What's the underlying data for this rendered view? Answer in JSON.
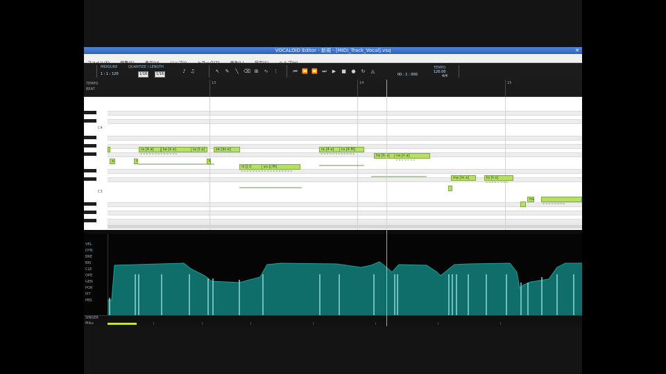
{
  "window": {
    "title": "VOCALOID Editor - 新規 - [MIDI_Track_Vocal].vsq",
    "close_glyph": "✕"
  },
  "menu": [
    "ファイル(F)",
    "編集(E)",
    "表示(V)",
    "ジョブ(J)",
    "トラック(T)",
    "再生(L)",
    "設定(S)",
    "ヘルプ(H)"
  ],
  "toolbar": {
    "measure_label": "MEASURE",
    "quantize_label": "QUANTIZE / LENGTH",
    "position_value": "1 : 1 : 120",
    "quantize_value": "1/16",
    "length_value": "1/16",
    "time_value": "00 : 1 : 000",
    "tempo_label": "TEMPO",
    "tempo_value": "120.00",
    "beat_value": "4/4"
  },
  "ruler": {
    "labels": [
      "TEMPO",
      "BEAT"
    ],
    "measures": [
      "13",
      "14",
      "15"
    ]
  },
  "keyboard": {
    "octave_labels": [
      "C4",
      "C3"
    ]
  },
  "notes": [
    {
      "lyric": "a"
    },
    {
      "lyric": "a [a]"
    },
    {
      "lyric": "ra [4 a]"
    },
    {
      "lyric": "ke [k e]"
    },
    {
      "lyric": "ta [t a]"
    },
    {
      "lyric": "no [n o]"
    },
    {
      "lyric": "ka [k a]"
    },
    {
      "lyric": "ze [dz e]"
    },
    {
      "lyric": "ni [J i]"
    },
    {
      "lyric": "yu [j M]"
    },
    {
      "lyric": "re [4 e]"
    },
    {
      "lyric": "ru [4 M]"
    },
    {
      "lyric": "ha [h a]"
    },
    {
      "lyric": "na [n a]"
    },
    {
      "lyric": "ma [m a]"
    },
    {
      "lyric": "to [t o]"
    },
    {
      "lyric": "mo [m o]"
    }
  ],
  "controls": {
    "parameters": [
      "VEL",
      "DYN",
      "BRE",
      "BRI",
      "CLE",
      "OPE",
      "GEN",
      "POR",
      "PIT",
      "PBS"
    ],
    "active": "DYN"
  },
  "bottom": {
    "labels": [
      "SINGER",
      "Miku"
    ]
  },
  "colors": {
    "note_fill": "#b6df67",
    "note_border": "#7fa838",
    "dynamics_fill": "#0f6e6a",
    "dynamics_line": "#8fd8d4",
    "title_bar": "#3b72c7",
    "tempo_bar": "#c9e23b"
  }
}
